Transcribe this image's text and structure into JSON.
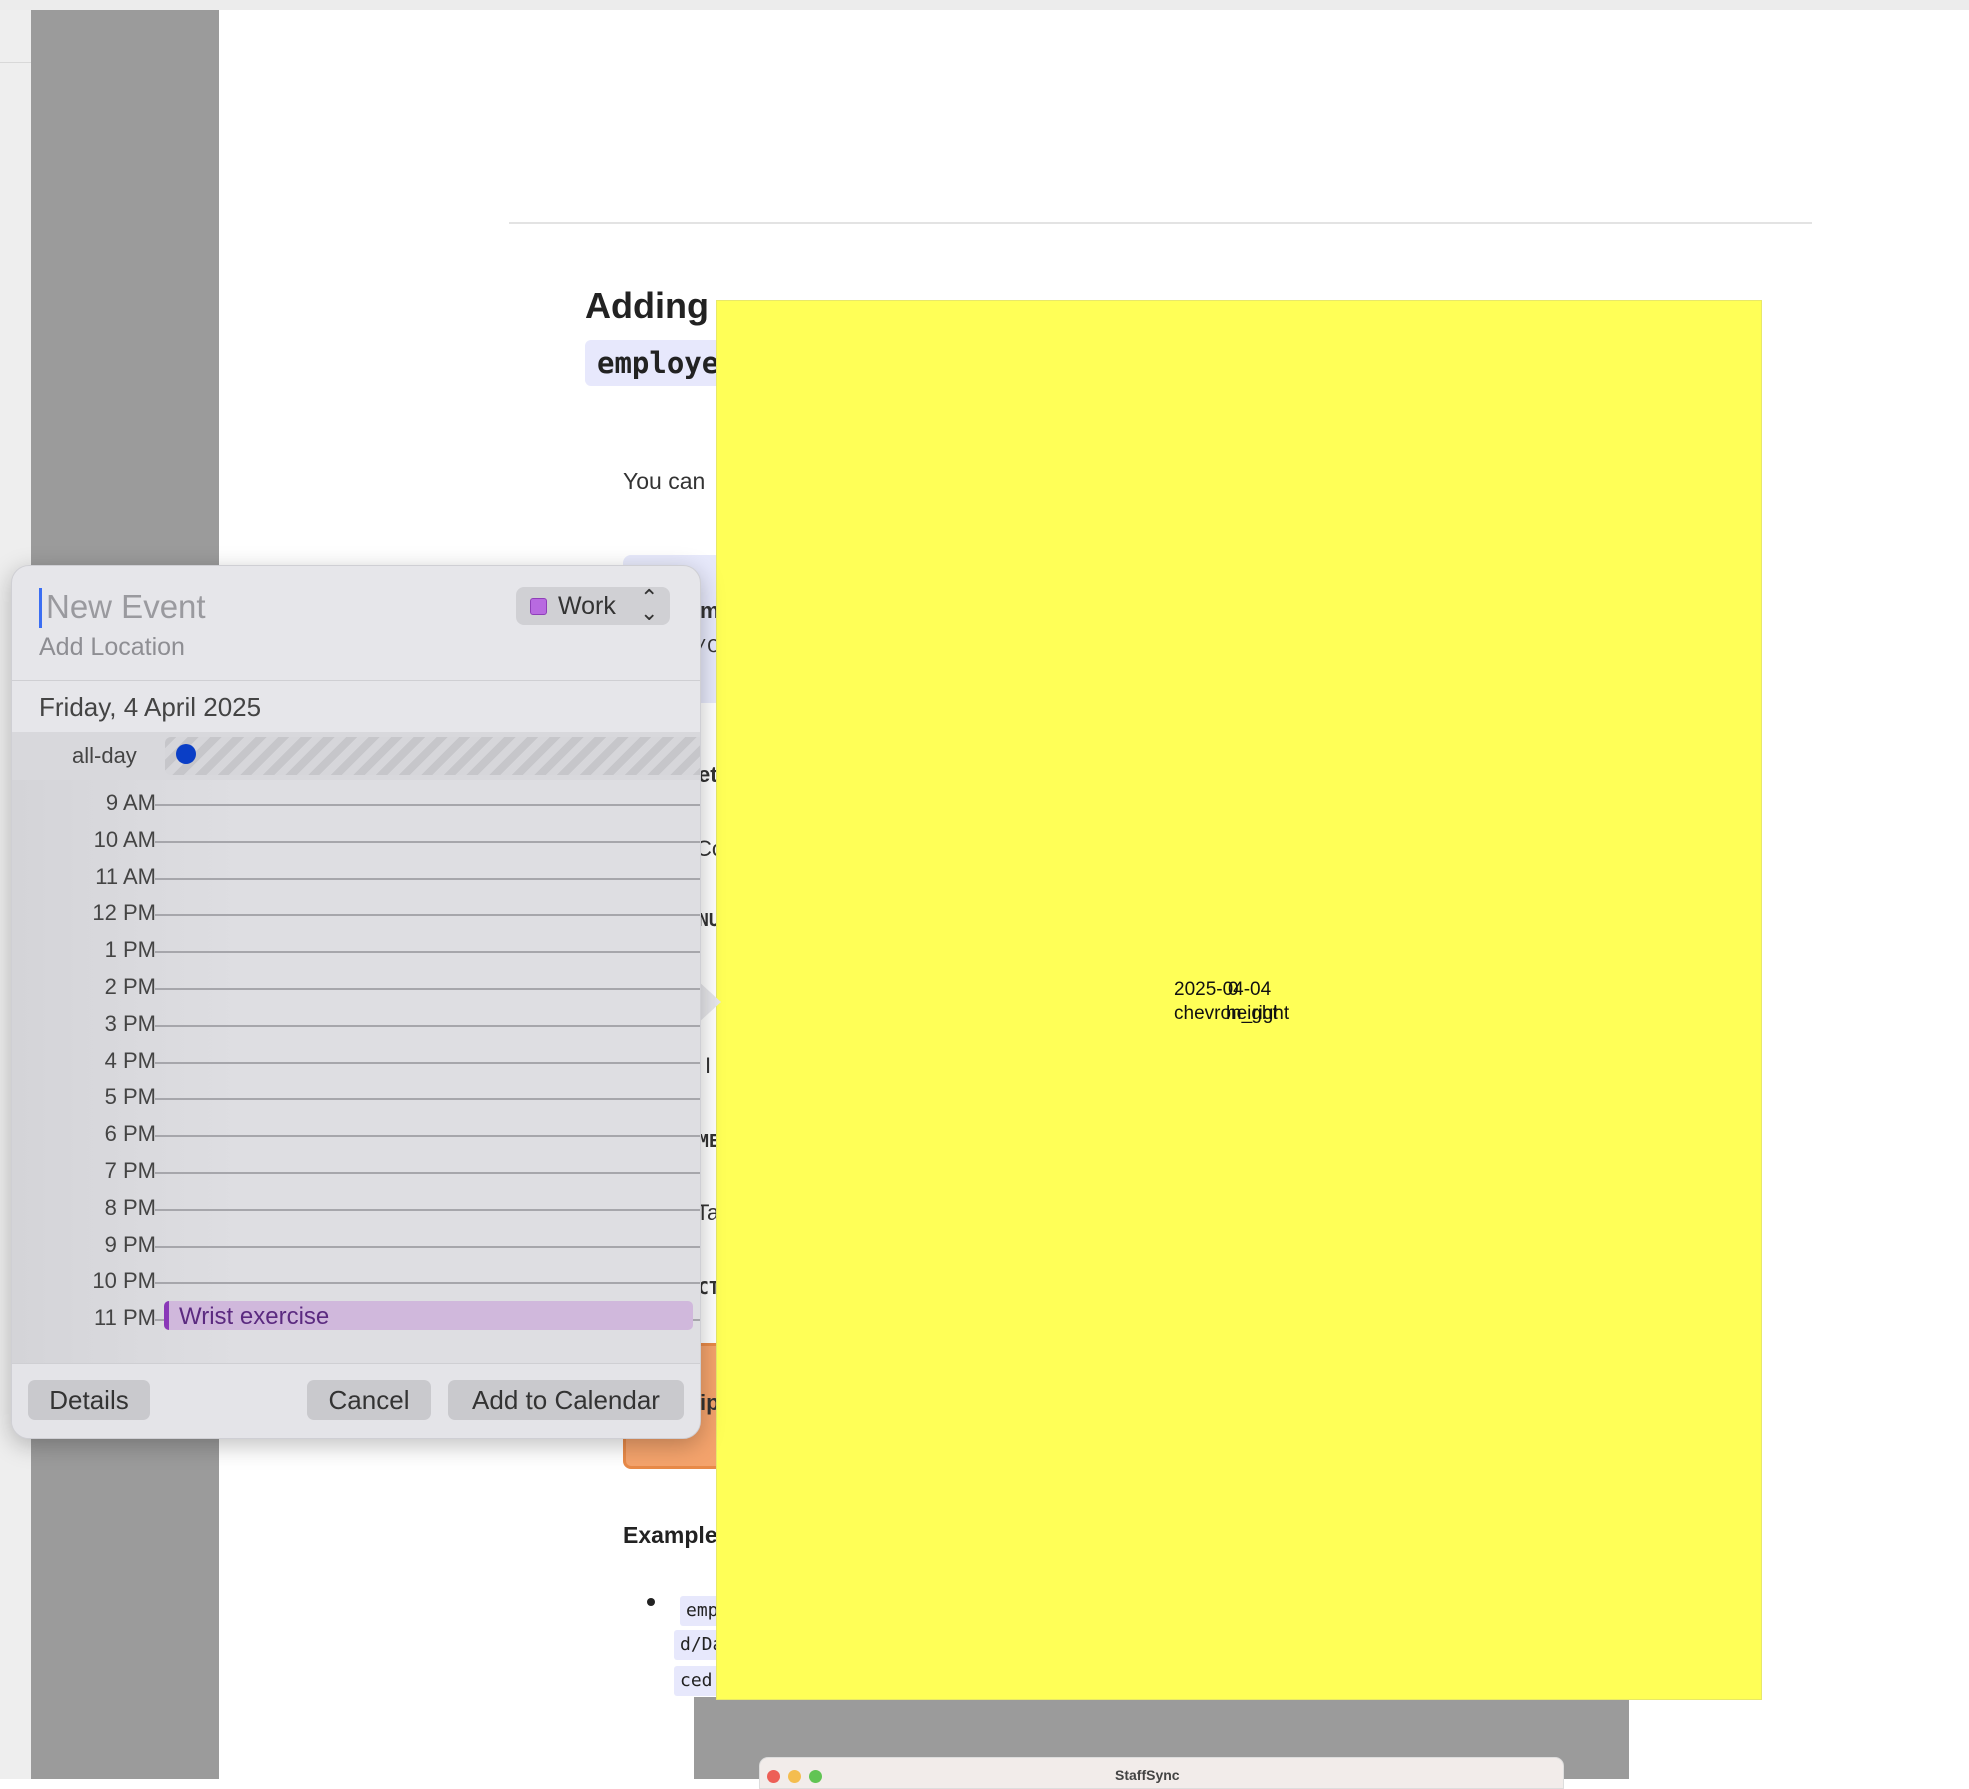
{
  "document": {
    "heading": "Adding",
    "code_chip": "employe",
    "intro": "You can",
    "example_label": "Example",
    "side_fragments": {
      "m": "m",
      "c_slash": "/C",
      "et": "et",
      "co": "Co",
      "nu": "NU",
      "i": "I",
      "me": "ME",
      "ta": "Ta",
      "ct": "CT",
      "ip": "ip"
    },
    "code_lines": [
      "emp",
      "d/Da",
      "ced,"
    ]
  },
  "overlay": {
    "line1a": "2025-04-04",
    "line1b": "0",
    "line2a": "chevron_right",
    "line2b": "height"
  },
  "app_window": {
    "title": "StaffSync"
  },
  "event_popover": {
    "title_placeholder": "New Event",
    "location_placeholder": "Add Location",
    "calendar": {
      "name": "Work",
      "color": "#b86ae0"
    },
    "date": "Friday, 4 April 2025",
    "all_day_label": "all-day",
    "hours": [
      "9 AM",
      "10 AM",
      "11 AM",
      "12 PM",
      "1 PM",
      "2 PM",
      "3 PM",
      "4 PM",
      "5 PM",
      "6 PM",
      "7 PM",
      "8 PM",
      "9 PM",
      "10 PM",
      "11 PM"
    ],
    "existing_event": "Wrist exercise",
    "buttons": {
      "details": "Details",
      "cancel": "Cancel",
      "add": "Add to Calendar"
    }
  }
}
